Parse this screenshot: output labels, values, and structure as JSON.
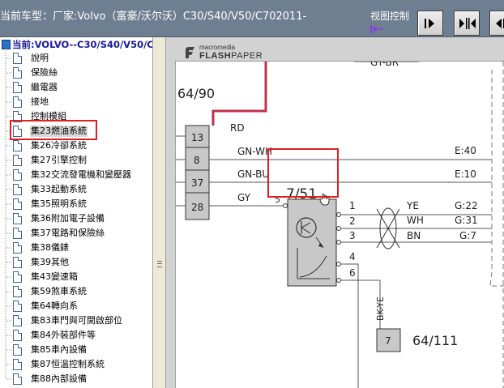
{
  "header": {
    "car_model": "当前车型：厂家:Volvo（富豪/沃尔沃）C30/S40/V50/C702011-",
    "view_control_label": "视图控制",
    "buttons": [
      {
        "icon": "next-page-icon"
      },
      {
        "icon": "fit-width-icon"
      },
      {
        "icon": "previous-page-icon"
      }
    ]
  },
  "tree": {
    "root_label": "当前:VOLVO--C30/S40/V50/C7",
    "items": [
      "說明",
      "保險絲",
      "繼電器",
      "接地",
      "控制模組",
      "集23燃油系統",
      "集26冷卻系統",
      "集27引擎控制",
      "集32交流發電機和變壓器",
      "集33起動系統",
      "集35照明系統",
      "集36附加電子設備",
      "集37電路和保險絲",
      "集38儀錶",
      "集39其他",
      "集43變速箱",
      "集59煞車系統",
      "集64轉向系",
      "集83車門與可開啟部位",
      "集84外裝部件等",
      "集85車內設備",
      "集87恒溫控制系統",
      "集88內部設備"
    ],
    "selected_index": 5
  },
  "viewer": {
    "logo_top": "macromedia",
    "logo_flash": "FLASH",
    "logo_paper": "PAPER"
  },
  "diagram": {
    "ref_top": "64/90",
    "ref_sensor": "7/51",
    "ref_bottom": "64/111",
    "top_wire_code": "GY-BR",
    "connector_pins": [
      "13",
      "8",
      "37",
      "28"
    ],
    "left_wires": [
      "RD",
      "GN-WH",
      "GN-BU",
      "GY"
    ],
    "left_pin_5": "5",
    "sensor_pins": [
      "1",
      "2",
      "3",
      "4",
      "6"
    ],
    "right_wires": [
      "YE",
      "WH",
      "BN"
    ],
    "right_codes": [
      "E:40",
      "E:10",
      "G:22",
      "G:31",
      "G:7"
    ],
    "bottom_wire": "BK-YE",
    "bottom_pin": "7"
  },
  "colors": {
    "header_bg": "#6f7f92",
    "highlight_red": "#e02020",
    "wire_red": "#c0304a",
    "component_gray": "#c8c8c8"
  }
}
